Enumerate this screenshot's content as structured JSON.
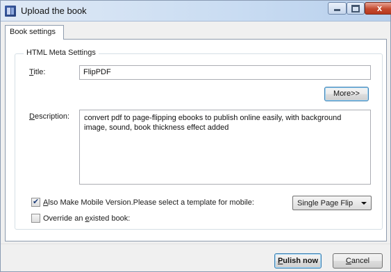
{
  "window": {
    "title": "Upload the book",
    "close_glyph": "x"
  },
  "tabs": [
    {
      "label": "Book settings",
      "selected": true
    }
  ],
  "group": {
    "legend": "HTML Meta Settings"
  },
  "form": {
    "title_label_accel": "T",
    "title_label_rest": "itle:",
    "title_value": "FlipPDF",
    "more_button": "More>>",
    "description_label_accel": "D",
    "description_label_rest": "escription:",
    "description_value": "convert pdf to page-flipping ebooks to publish online easily, with background image, sound, book thickness effect added",
    "mobile_checked": true,
    "mobile_label_accel": "A",
    "mobile_label_rest": "lso Make Mobile Version.Please select a template for mobile:",
    "mobile_template_selected": "Single Page Flip",
    "override_checked": false,
    "override_label_pre": "Override an ",
    "override_label_accel": "e",
    "override_label_post": "xisted book:"
  },
  "footer": {
    "publish_accel": "P",
    "publish_rest": "ulish now",
    "cancel_accel": "C",
    "cancel_rest": "ancel"
  },
  "icons": {
    "app": "book-app-icon",
    "minimize": "minimize-icon",
    "maximize": "maximize-icon",
    "close": "close-icon",
    "dropdown": "chevron-down-icon",
    "check": "checkmark-icon"
  },
  "colors": {
    "titlebar": "#c9dcf2",
    "close_button": "#c44a2f",
    "focus_border": "#3c7fb1"
  }
}
